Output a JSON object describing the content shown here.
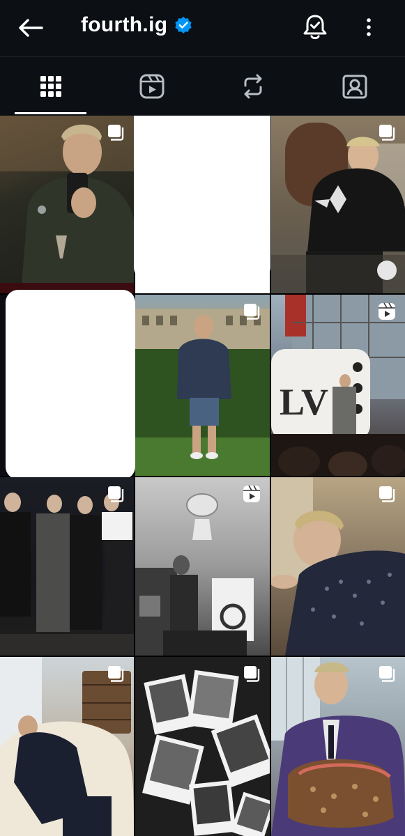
{
  "header": {
    "username": "fourth.ig",
    "back_icon": "arrow-left-icon",
    "verified_icon": "verified-badge-icon",
    "notification_icon": "bell-check-icon",
    "more_icon": "more-vertical-icon"
  },
  "tabs": [
    {
      "name": "posts",
      "icon": "grid-icon",
      "active": true
    },
    {
      "name": "reels",
      "icon": "reels-icon",
      "active": false
    },
    {
      "name": "reposts",
      "icon": "repost-icon",
      "active": false
    },
    {
      "name": "tagged",
      "icon": "tagged-user-icon",
      "active": false
    }
  ],
  "grid": {
    "items": [
      {
        "type": "carousel",
        "scene": "mirror-selfie-party"
      },
      {
        "type": "blank",
        "scene": "white-placeholder"
      },
      {
        "type": "carousel",
        "scene": "black-jacket-street"
      },
      {
        "type": "blank",
        "scene": "white-placeholder"
      },
      {
        "type": "carousel",
        "scene": "garden-denim-outfit"
      },
      {
        "type": "reel",
        "scene": "lv-dice-sculpture"
      },
      {
        "type": "carousel",
        "scene": "group-black-suits"
      },
      {
        "type": "reel",
        "scene": "bw-gym-chandelier"
      },
      {
        "type": "carousel",
        "scene": "tweed-jacket-closeup"
      },
      {
        "type": "carousel",
        "scene": "sofa-luggage-room"
      },
      {
        "type": "carousel",
        "scene": "bw-polaroid-collage"
      },
      {
        "type": "carousel",
        "scene": "purple-sweater-monogram-bag"
      }
    ]
  },
  "colors": {
    "background": "#000000",
    "header_bg": "#0c1014",
    "verified_blue": "#0095f6",
    "text": "#ffffff"
  }
}
